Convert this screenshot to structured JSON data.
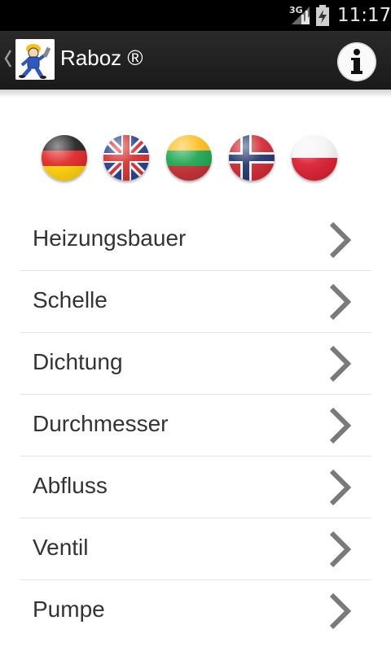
{
  "status_bar": {
    "network": "3G",
    "time": "11:17"
  },
  "action_bar": {
    "title": "Raboz ®",
    "logo_icon": "plumber-logo-icon",
    "info_icon": "info-icon",
    "up_icon": "up-caret-icon"
  },
  "languages": [
    {
      "name": "flag-germany-icon"
    },
    {
      "name": "flag-uk-icon"
    },
    {
      "name": "flag-lithuania-icon"
    },
    {
      "name": "flag-norway-icon"
    },
    {
      "name": "flag-poland-icon"
    }
  ],
  "items": [
    {
      "label": "Heizungsbauer"
    },
    {
      "label": "Schelle"
    },
    {
      "label": "Dichtung"
    },
    {
      "label": "Durchmesser"
    },
    {
      "label": "Abfluss"
    },
    {
      "label": "Ventil"
    },
    {
      "label": "Pumpe"
    }
  ],
  "colors": {
    "action_bar": "#222222",
    "status_bar": "#000000",
    "chevron": "#7a7a7a",
    "divider": "#e2e2e2"
  }
}
